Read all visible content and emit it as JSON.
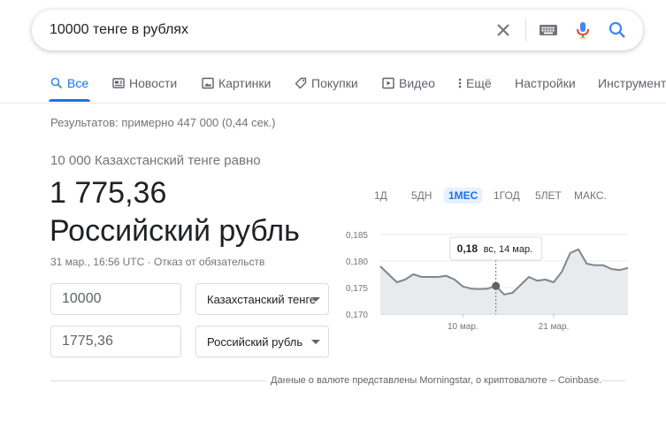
{
  "search": {
    "query": "10000 тенге в рублях"
  },
  "tabs": [
    {
      "label": "Все"
    },
    {
      "label": "Новости"
    },
    {
      "label": "Картинки"
    },
    {
      "label": "Покупки"
    },
    {
      "label": "Видео"
    },
    {
      "label": "Ещё"
    },
    {
      "label": "Настройки"
    },
    {
      "label": "Инструменты"
    }
  ],
  "result_stats": "Результатов: примерно 447 000 (0,44 сек.)",
  "converter": {
    "equals_label": "10 000 Казахстанский тенге равно",
    "big_value": "1 775,36",
    "big_currency": "Российский рубль",
    "timestamp": "31 мар., 16:56 UTC · Отказ от обязательств",
    "from_amount": "10000",
    "from_currency": "Казахстанский тенге",
    "to_amount": "1775,36",
    "to_currency": "Российский рубль",
    "source_note": "Данные о валюте представлены Morningstar, о криптовалюте – Coinbase."
  },
  "ranges": [
    {
      "label": "1Д",
      "active": false
    },
    {
      "label": "5ДН",
      "active": false
    },
    {
      "label": "1МЕС",
      "active": true
    },
    {
      "label": "1ГОД",
      "active": false
    },
    {
      "label": "5ЛЕТ",
      "active": false
    },
    {
      "label": "МАКС.",
      "active": false
    }
  ],
  "tooltip": {
    "value": "0,18",
    "date": "вс, 14 мар."
  },
  "colors": {
    "accent": "#1a73e8",
    "line": "#80868b",
    "area": "#e8eaed"
  },
  "chart_data": {
    "type": "area",
    "ylim": [
      0.17,
      0.185
    ],
    "yticks": [
      "0,185",
      "0,180",
      "0,175",
      "0,170"
    ],
    "ytick_values": [
      0.185,
      0.18,
      0.175,
      0.17
    ],
    "xticks": [
      {
        "label": "10 мар.",
        "index": 10
      },
      {
        "label": "21 мар.",
        "index": 21
      }
    ],
    "highlight_index": 14,
    "series": [
      {
        "values": [
          0.179,
          0.1775,
          0.176,
          0.1765,
          0.1775,
          0.177,
          0.177,
          0.177,
          0.1772,
          0.1765,
          0.1752,
          0.1748,
          0.1747,
          0.1748,
          0.1753,
          0.1737,
          0.174,
          0.1755,
          0.177,
          0.1763,
          0.1765,
          0.176,
          0.178,
          0.1815,
          0.1822,
          0.1795,
          0.1792,
          0.1792,
          0.1785,
          0.1783,
          0.1787
        ]
      }
    ]
  }
}
